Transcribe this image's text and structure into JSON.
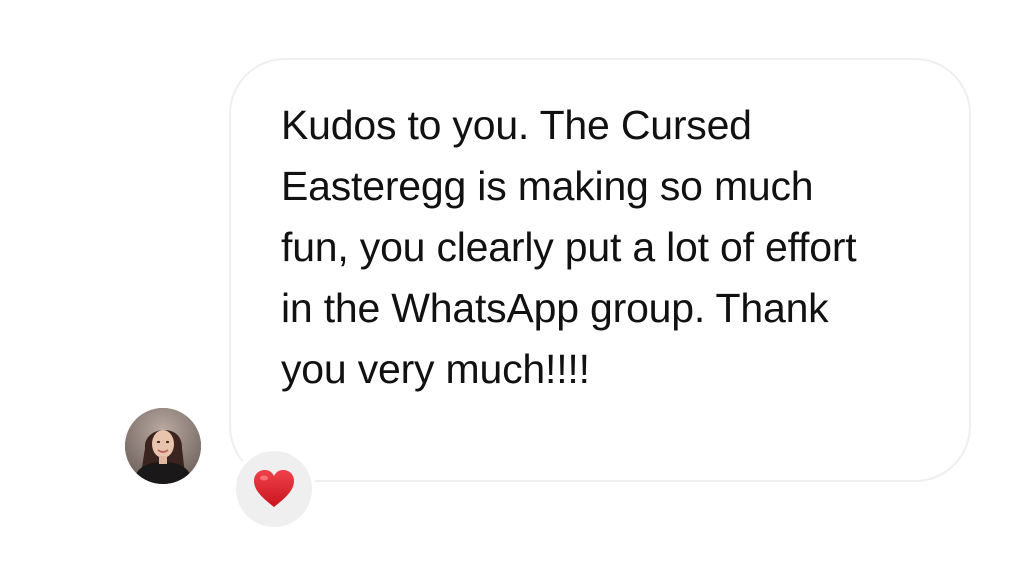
{
  "message": {
    "lines": [
      "Kudos to you. The Cursed",
      "Easteregg is making so much",
      "fun, you clearly put a lot of effort",
      "in the WhatsApp group. Thank",
      "you very much!!!!"
    ]
  },
  "sender": {
    "avatar_icon": "profile-photo"
  },
  "reaction": {
    "icon": "red-heart-icon",
    "color": "#e0242f"
  }
}
